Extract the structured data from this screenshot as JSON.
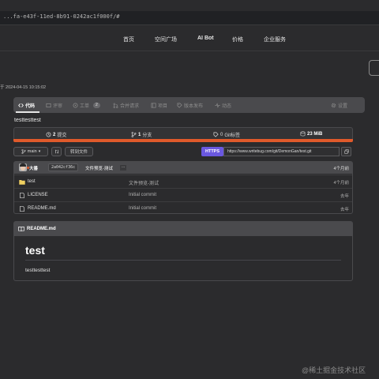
{
  "browser": {
    "url": "...fa-e43f-11ed-8b91-0242ac1f000f/#"
  },
  "nav": {
    "items": [
      "首页",
      "空间广场",
      "AI Bot",
      "价格",
      "企业服务"
    ]
  },
  "repo": {
    "created": "于 2024-04-15 10:15:02",
    "description": "testtesttest"
  },
  "tabs": {
    "code": "代码",
    "review": "评审",
    "issues": "工单",
    "issues_count": "2",
    "merge": "合并请求",
    "projects": "项目",
    "releases": "版本发布",
    "activity": "动态",
    "settings": "设置"
  },
  "stats": {
    "commits_num": "2",
    "commits_label": "提交",
    "branches_num": "1",
    "branches_label": "分支",
    "tags_num": "0",
    "tags_label": "Git标签",
    "size": "23 MiB"
  },
  "toolbar": {
    "branch": "main",
    "goto_file": "转到文件",
    "https": "HTTPS",
    "clone_url": "https://www.writebug.com/git/DemonGan/test.git"
  },
  "latest_commit": {
    "author": "大番",
    "sha": "2a042cf36c",
    "message": "文件预览-测试",
    "more": "...",
    "time": "4个月前"
  },
  "files": [
    {
      "name": "test",
      "type": "folder",
      "message": "文件预览-测试",
      "time": "4个月前"
    },
    {
      "name": "LICENSE",
      "type": "file",
      "message": "Initial commit",
      "time": "去年"
    },
    {
      "name": "README.md",
      "type": "file",
      "message": "Initial commit",
      "time": "去年"
    }
  ],
  "readme": {
    "title": "README.md",
    "h1": "test",
    "body": "testtesttest"
  },
  "watermark": "@稀土掘金技术社区",
  "colors": {
    "background": "#2b2b2d",
    "accent": "#6a58e0",
    "language_bar": "#e05a2b"
  }
}
